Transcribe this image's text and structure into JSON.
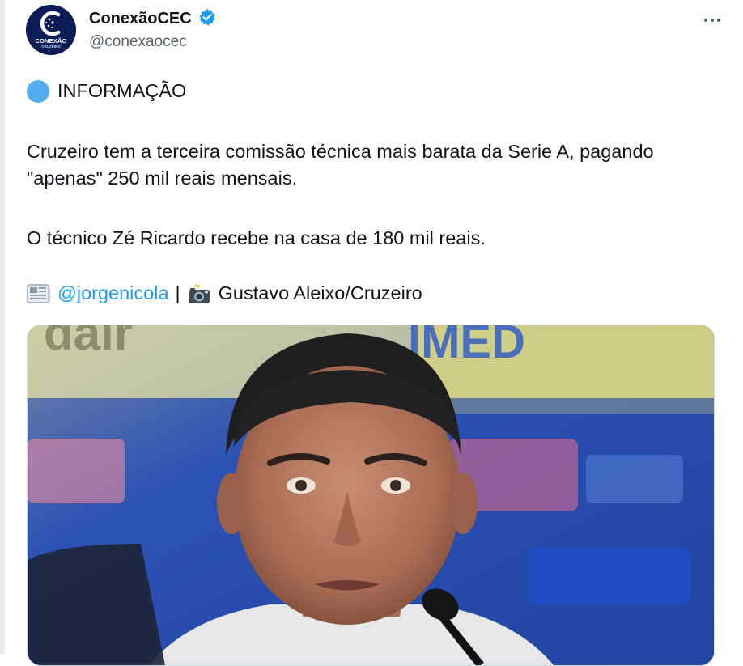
{
  "account": {
    "display_name": "ConexãoCEC",
    "handle": "@conexaocec",
    "avatar_text": "CONEXÃO",
    "avatar_subtext": "CRUZEIRO",
    "verified": true
  },
  "tweet": {
    "info_label": "INFORMAÇÃO",
    "paragraph1": "Cruzeiro tem a terceira comissão técnica mais barata da Serie A, pagando \"apenas\" 250 mil reais mensais.",
    "paragraph2": "O técnico Zé Ricardo recebe na casa de 180 mil reais.",
    "credit_mention": "@jorgenicola",
    "credit_separator": "|",
    "credit_photo": "Gustavo Aleixo/Cruzeiro"
  },
  "icons": {
    "more": "more-options-icon",
    "verified": "verified-badge-icon",
    "info": "blue-circle-emoji",
    "news": "newspaper-emoji",
    "camera": "camera-flash-emoji"
  },
  "colors": {
    "link": "#1d9bf0",
    "verified": "#1d9bf0",
    "secondary_text": "#536471",
    "avatar_bg": "#0b1c57",
    "info_circle": "#55acee"
  },
  "media": {
    "background_text_top_left": "dair",
    "background_text_top_right": "IMED"
  }
}
